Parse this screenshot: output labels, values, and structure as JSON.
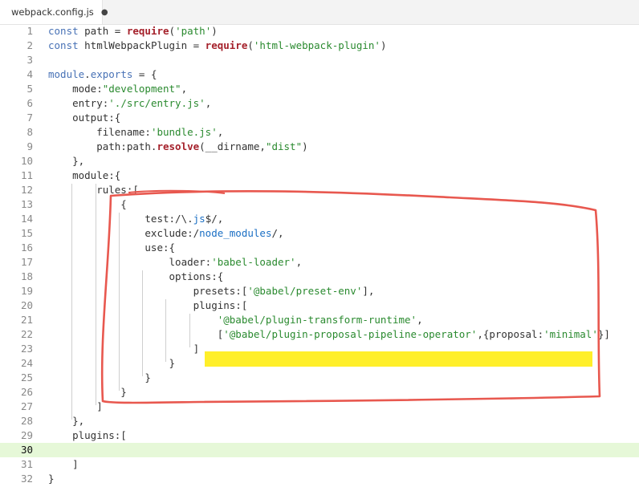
{
  "tab": {
    "filename": "webpack.config.js",
    "modified_indicator": "●",
    "icon": "gear-config-icon"
  },
  "annotation_color": "#e8584f",
  "highlight_color": "#ffef2a",
  "current_line_color": "#e6f8d8",
  "lines": [
    {
      "n": "1",
      "segs": [
        {
          "c": "kw",
          "t": "const "
        },
        {
          "c": "",
          "t": "path = "
        },
        {
          "c": "fn",
          "t": "require"
        },
        {
          "c": "",
          "t": "("
        },
        {
          "c": "str",
          "t": "'path'"
        },
        {
          "c": "",
          "t": ")"
        }
      ]
    },
    {
      "n": "2",
      "segs": [
        {
          "c": "kw",
          "t": "const "
        },
        {
          "c": "",
          "t": "htmlWebpackPlugin = "
        },
        {
          "c": "fn",
          "t": "require"
        },
        {
          "c": "",
          "t": "("
        },
        {
          "c": "str",
          "t": "'html-webpack-plugin'"
        },
        {
          "c": "",
          "t": ")"
        }
      ]
    },
    {
      "n": "3",
      "segs": []
    },
    {
      "n": "4",
      "segs": [
        {
          "c": "kw",
          "t": "module"
        },
        {
          "c": "",
          "t": "."
        },
        {
          "c": "kw",
          "t": "exports"
        },
        {
          "c": "",
          "t": " = {"
        }
      ]
    },
    {
      "n": "5",
      "segs": [
        {
          "c": "",
          "t": "    mode:"
        },
        {
          "c": "str",
          "t": "\"development\""
        },
        {
          "c": "",
          "t": ","
        }
      ]
    },
    {
      "n": "6",
      "segs": [
        {
          "c": "",
          "t": "    entry:"
        },
        {
          "c": "str",
          "t": "'./src/entry.js'"
        },
        {
          "c": "",
          "t": ","
        }
      ]
    },
    {
      "n": "7",
      "segs": [
        {
          "c": "",
          "t": "    output:{"
        }
      ]
    },
    {
      "n": "8",
      "segs": [
        {
          "c": "",
          "t": "        filename:"
        },
        {
          "c": "str",
          "t": "'bundle.js'"
        },
        {
          "c": "",
          "t": ","
        }
      ]
    },
    {
      "n": "9",
      "segs": [
        {
          "c": "",
          "t": "        path:path."
        },
        {
          "c": "fn",
          "t": "resolve"
        },
        {
          "c": "",
          "t": "(__dirname,"
        },
        {
          "c": "str",
          "t": "\"dist\""
        },
        {
          "c": "",
          "t": ")"
        }
      ]
    },
    {
      "n": "10",
      "segs": [
        {
          "c": "",
          "t": "    },"
        }
      ]
    },
    {
      "n": "11",
      "segs": [
        {
          "c": "",
          "t": "    module:{"
        }
      ]
    },
    {
      "n": "12",
      "segs": [
        {
          "c": "",
          "t": "        rules:["
        }
      ]
    },
    {
      "n": "13",
      "segs": [
        {
          "c": "",
          "t": "            {"
        }
      ]
    },
    {
      "n": "14",
      "segs": [
        {
          "c": "",
          "t": "                test:/\\."
        },
        {
          "c": "rx",
          "t": "js"
        },
        {
          "c": "",
          "t": "$/,"
        }
      ]
    },
    {
      "n": "15",
      "segs": [
        {
          "c": "",
          "t": "                exclude:/"
        },
        {
          "c": "rx",
          "t": "node_modules"
        },
        {
          "c": "",
          "t": "/,"
        }
      ]
    },
    {
      "n": "16",
      "segs": [
        {
          "c": "",
          "t": "                use:{"
        }
      ]
    },
    {
      "n": "17",
      "segs": [
        {
          "c": "",
          "t": "                    loader:"
        },
        {
          "c": "str",
          "t": "'babel-loader'"
        },
        {
          "c": "",
          "t": ","
        }
      ]
    },
    {
      "n": "18",
      "segs": [
        {
          "c": "",
          "t": "                    options:{"
        }
      ]
    },
    {
      "n": "19",
      "segs": [
        {
          "c": "",
          "t": "                        presets:["
        },
        {
          "c": "str",
          "t": "'@babel/preset-env'"
        },
        {
          "c": "",
          "t": "],"
        }
      ]
    },
    {
      "n": "20",
      "segs": [
        {
          "c": "",
          "t": "                        plugins:["
        }
      ]
    },
    {
      "n": "21",
      "segs": [
        {
          "c": "",
          "t": "                            "
        },
        {
          "c": "str",
          "t": "'@babel/plugin-transform-runtime'"
        },
        {
          "c": "",
          "t": ","
        }
      ]
    },
    {
      "n": "22",
      "segs": [
        {
          "c": "",
          "t": "                            ["
        },
        {
          "c": "str",
          "t": "'@babel/plugin-proposal-pipeline-operator'"
        },
        {
          "c": "",
          "t": ",{proposal:"
        },
        {
          "c": "str",
          "t": "'minimal'"
        },
        {
          "c": "",
          "t": "}]"
        }
      ]
    },
    {
      "n": "23",
      "segs": [
        {
          "c": "",
          "t": "                        ]"
        }
      ]
    },
    {
      "n": "24",
      "segs": [
        {
          "c": "",
          "t": "                    }"
        }
      ]
    },
    {
      "n": "25",
      "segs": [
        {
          "c": "",
          "t": "                }"
        }
      ]
    },
    {
      "n": "26",
      "segs": [
        {
          "c": "",
          "t": "            }"
        }
      ]
    },
    {
      "n": "27",
      "segs": [
        {
          "c": "",
          "t": "        ]"
        }
      ]
    },
    {
      "n": "28",
      "segs": [
        {
          "c": "",
          "t": "    },"
        }
      ]
    },
    {
      "n": "29",
      "segs": [
        {
          "c": "",
          "t": "    plugins:["
        }
      ]
    },
    {
      "n": "30",
      "segs": []
    },
    {
      "n": "31",
      "segs": [
        {
          "c": "",
          "t": "    ]"
        }
      ]
    },
    {
      "n": "32",
      "segs": [
        {
          "c": "",
          "t": "}"
        }
      ]
    }
  ]
}
